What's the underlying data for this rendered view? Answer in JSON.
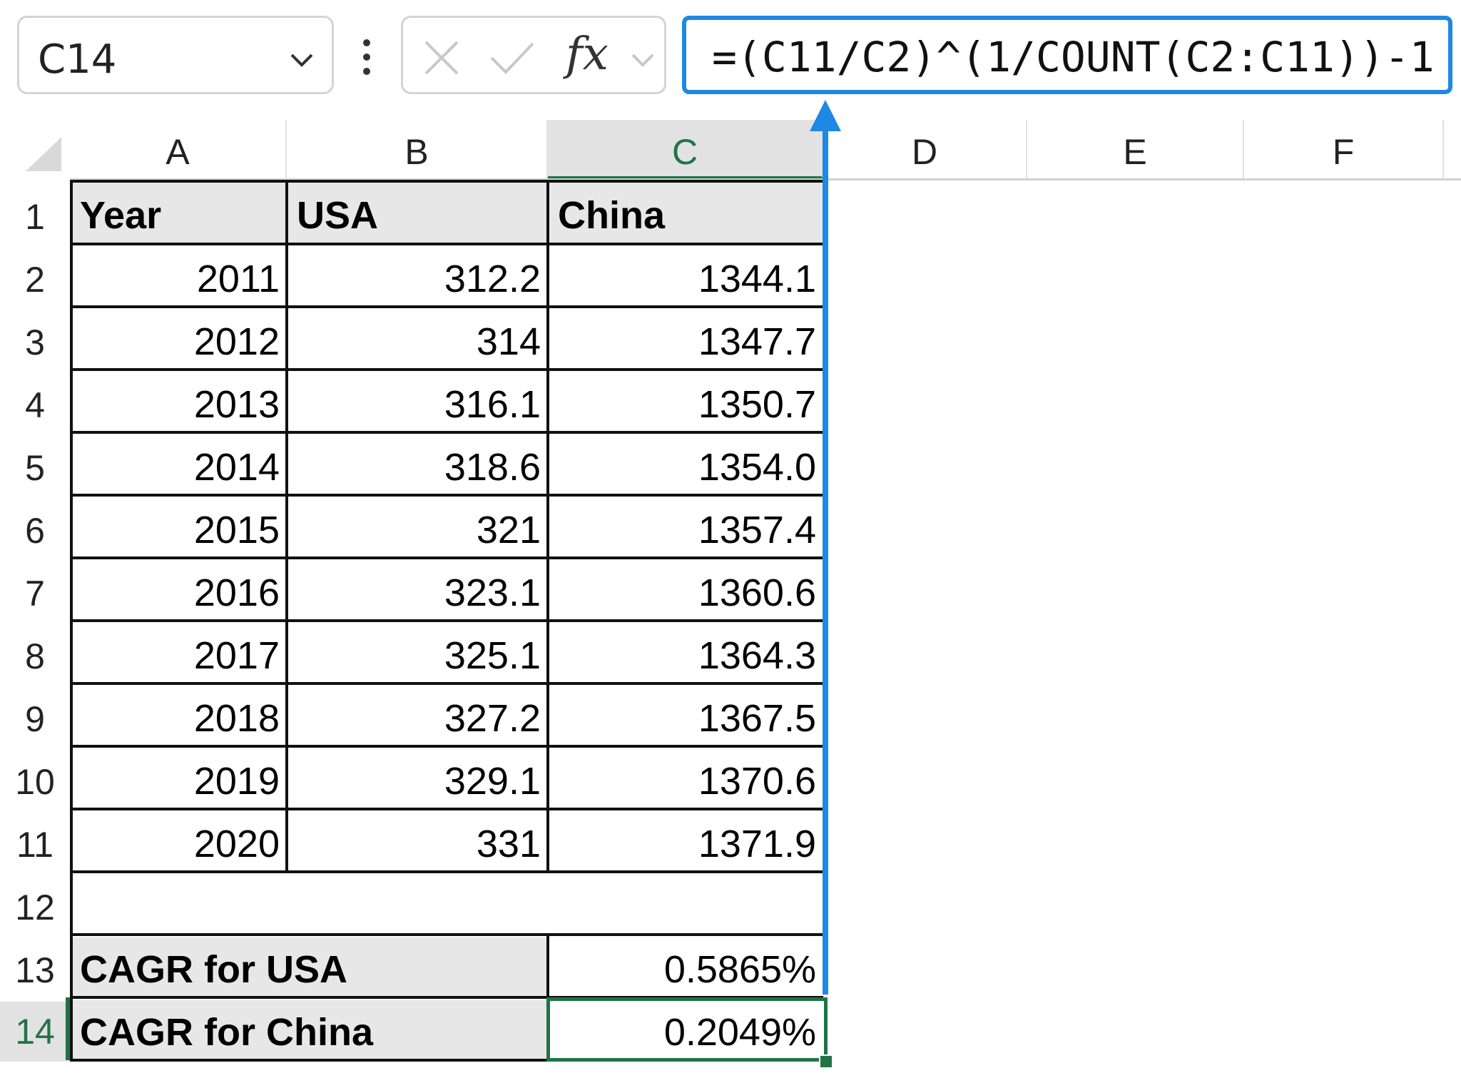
{
  "name_box": {
    "value": "C14"
  },
  "formula_bar": {
    "fx_label": "fx",
    "formula": "=(C11/C2)^(1/COUNT(C2:C11))-1"
  },
  "columns": [
    "A",
    "B",
    "C",
    "D",
    "E",
    "F"
  ],
  "selected_column": "C",
  "rows": [
    "1",
    "2",
    "3",
    "4",
    "5",
    "6",
    "7",
    "8",
    "9",
    "10",
    "11",
    "12",
    "13",
    "14"
  ],
  "selected_row": "14",
  "table": {
    "headers": [
      "Year",
      "USA",
      "China"
    ],
    "data": [
      [
        "2011",
        "312.2",
        "1344.1"
      ],
      [
        "2012",
        "314",
        "1347.7"
      ],
      [
        "2013",
        "316.1",
        "1350.7"
      ],
      [
        "2014",
        "318.6",
        "1354.0"
      ],
      [
        "2015",
        "321",
        "1357.4"
      ],
      [
        "2016",
        "323.1",
        "1360.6"
      ],
      [
        "2017",
        "325.1",
        "1364.3"
      ],
      [
        "2018",
        "327.2",
        "1367.5"
      ],
      [
        "2019",
        "329.1",
        "1370.6"
      ],
      [
        "2020",
        "331",
        "1371.9"
      ]
    ]
  },
  "summary": [
    {
      "label": "CAGR for USA",
      "value": "0.5865%"
    },
    {
      "label": "CAGR for China",
      "value": "0.2049%"
    }
  ],
  "colors": {
    "selection": "#217346",
    "trace_arrow": "#1e88e5",
    "header_fill": "#e7e7e7"
  }
}
